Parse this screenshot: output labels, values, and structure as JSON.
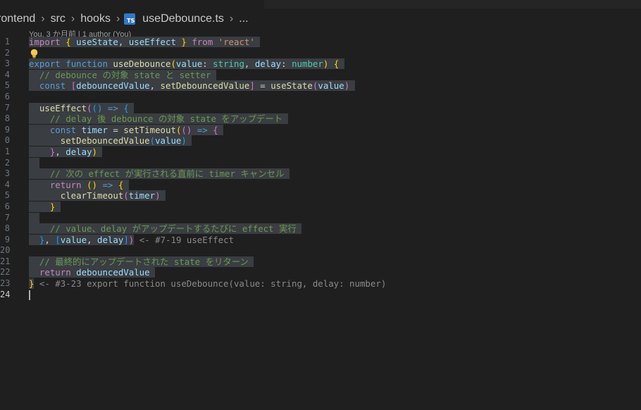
{
  "breadcrumb": {
    "items": [
      "rontend",
      "src",
      "hooks"
    ],
    "file_badge": "TS",
    "file_name": "useDebounce.ts",
    "ellipsis": "..."
  },
  "blame": "You, 3 か月前 | 1 author (You)",
  "line_numbers": [
    "1",
    "2",
    "3",
    "4",
    "5",
    "6",
    "7",
    "8",
    "9",
    "0",
    "1",
    "2",
    "3",
    "4",
    "5",
    "6",
    "7",
    "8",
    "9",
    "20",
    "21",
    "22",
    "23",
    "24"
  ],
  "code_lines": [
    [
      [
        "sel",
        ""
      ],
      [
        "ctl",
        "import"
      ],
      [
        "pl",
        " "
      ],
      [
        "br1",
        "{"
      ],
      [
        "pl",
        " "
      ],
      [
        "var",
        "useState"
      ],
      [
        "pl",
        ", "
      ],
      [
        "var",
        "useEffect"
      ],
      [
        "pl",
        " "
      ],
      [
        "br1",
        "}"
      ],
      [
        "pl",
        " "
      ],
      [
        "ctl",
        "from"
      ],
      [
        "pl",
        " "
      ],
      [
        "str",
        "'react'"
      ],
      [
        "pl",
        " "
      ]
    ],
    [
      [
        "bulb",
        ""
      ]
    ],
    [
      [
        "sel",
        ""
      ],
      [
        "kw",
        "export"
      ],
      [
        "pl",
        " "
      ],
      [
        "kw",
        "function"
      ],
      [
        "pl",
        " "
      ],
      [
        "fn",
        "useDebounce"
      ],
      [
        "br1",
        "("
      ],
      [
        "var",
        "value"
      ],
      [
        "pl",
        ": "
      ],
      [
        "ty",
        "string"
      ],
      [
        "pl",
        ", "
      ],
      [
        "var",
        "delay"
      ],
      [
        "pl",
        ": "
      ],
      [
        "ty",
        "number"
      ],
      [
        "br1",
        ")"
      ],
      [
        "pl",
        " "
      ],
      [
        "br1",
        "{"
      ],
      [
        "pl",
        " "
      ]
    ],
    [
      [
        "sel",
        ""
      ],
      [
        "ind",
        "  "
      ],
      [
        "cmt",
        "// debounce の対象 state と setter "
      ]
    ],
    [
      [
        "sel",
        ""
      ],
      [
        "ind",
        "  "
      ],
      [
        "kw",
        "const"
      ],
      [
        "pl",
        " "
      ],
      [
        "br2",
        "["
      ],
      [
        "var",
        "debouncedValue"
      ],
      [
        "pl",
        ", "
      ],
      [
        "fn",
        "setDebouncedValue"
      ],
      [
        "br2",
        "]"
      ],
      [
        "pl",
        " = "
      ],
      [
        "fn",
        "useState"
      ],
      [
        "br2",
        "("
      ],
      [
        "var",
        "value"
      ],
      [
        "br2",
        ")"
      ],
      [
        "pl",
        " "
      ]
    ],
    [
      [
        "plain",
        ""
      ]
    ],
    [
      [
        "sel",
        ""
      ],
      [
        "ind",
        "  "
      ],
      [
        "fn",
        "useEffect"
      ],
      [
        "br2",
        "("
      ],
      [
        "br3",
        "()"
      ],
      [
        "pl",
        " "
      ],
      [
        "kw",
        "=>"
      ],
      [
        "pl",
        " "
      ],
      [
        "br3",
        "{"
      ],
      [
        "pl",
        " "
      ]
    ],
    [
      [
        "sel",
        ""
      ],
      [
        "ind",
        "    "
      ],
      [
        "cmt",
        "// delay 後 debounce の対象 state をアップデート "
      ]
    ],
    [
      [
        "sel",
        ""
      ],
      [
        "ind",
        "    "
      ],
      [
        "kw",
        "const"
      ],
      [
        "pl",
        " "
      ],
      [
        "var",
        "timer"
      ],
      [
        "pl",
        " = "
      ],
      [
        "fn",
        "setTimeout"
      ],
      [
        "br1",
        "("
      ],
      [
        "br2",
        "()"
      ],
      [
        "pl",
        " "
      ],
      [
        "kw",
        "=>"
      ],
      [
        "pl",
        " "
      ],
      [
        "br2",
        "{"
      ],
      [
        "pl",
        " "
      ]
    ],
    [
      [
        "sel",
        ""
      ],
      [
        "ind",
        "      "
      ],
      [
        "fn",
        "setDebouncedValue"
      ],
      [
        "br3",
        "("
      ],
      [
        "var",
        "value"
      ],
      [
        "br3",
        ")"
      ],
      [
        "pl",
        " "
      ]
    ],
    [
      [
        "sel",
        ""
      ],
      [
        "ind",
        "    "
      ],
      [
        "br2",
        "}"
      ],
      [
        "pl",
        ", "
      ],
      [
        "var",
        "delay"
      ],
      [
        "br1",
        ")"
      ],
      [
        "pl",
        " "
      ]
    ],
    [
      [
        "sel",
        ""
      ],
      [
        "ind",
        "  "
      ]
    ],
    [
      [
        "sel",
        ""
      ],
      [
        "ind",
        "    "
      ],
      [
        "cmt",
        "// 次の effect が実行される直前に timer キャンセル "
      ]
    ],
    [
      [
        "sel",
        ""
      ],
      [
        "ind",
        "    "
      ],
      [
        "ctl",
        "return"
      ],
      [
        "pl",
        " "
      ],
      [
        "br1",
        "()"
      ],
      [
        "pl",
        " "
      ],
      [
        "kw",
        "=>"
      ],
      [
        "pl",
        " "
      ],
      [
        "br1",
        "{"
      ],
      [
        "pl",
        " "
      ]
    ],
    [
      [
        "sel",
        ""
      ],
      [
        "ind",
        "      "
      ],
      [
        "fn",
        "clearTimeout"
      ],
      [
        "br2",
        "("
      ],
      [
        "var",
        "timer"
      ],
      [
        "br2",
        ")"
      ],
      [
        "pl",
        " "
      ]
    ],
    [
      [
        "sel",
        ""
      ],
      [
        "ind",
        "    "
      ],
      [
        "br1",
        "}"
      ],
      [
        "pl",
        " "
      ]
    ],
    [
      [
        "sel",
        ""
      ],
      [
        "ind",
        "  "
      ]
    ],
    [
      [
        "sel",
        ""
      ],
      [
        "ind",
        "    "
      ],
      [
        "cmt",
        "// value、delay がアップデートするたびに effect 実行 "
      ]
    ],
    [
      [
        "sel",
        ""
      ],
      [
        "ind",
        "  "
      ],
      [
        "br3",
        "}"
      ],
      [
        "pl",
        ", "
      ],
      [
        "br3",
        "["
      ],
      [
        "var",
        "value"
      ],
      [
        "pl",
        ", "
      ],
      [
        "var",
        "delay"
      ],
      [
        "br3",
        "]"
      ],
      [
        "br2",
        ")"
      ],
      [
        "hint",
        " <- #7-19 useEffect"
      ]
    ],
    [
      [
        "plain",
        ""
      ]
    ],
    [
      [
        "sel",
        ""
      ],
      [
        "ind",
        "  "
      ],
      [
        "cmt",
        "// 最終的にアップデートされた state をリターン "
      ]
    ],
    [
      [
        "sel",
        ""
      ],
      [
        "ind",
        "  "
      ],
      [
        "ctl",
        "return"
      ],
      [
        "pl",
        " "
      ],
      [
        "var",
        "debouncedValue"
      ],
      [
        "pl",
        " "
      ]
    ],
    [
      [
        "sel",
        ""
      ],
      [
        "br1",
        "}"
      ],
      [
        "hint",
        " <- #3-23 export function useDebounce(value: string, delay: number)"
      ]
    ],
    [
      [
        "caret",
        ""
      ]
    ]
  ]
}
